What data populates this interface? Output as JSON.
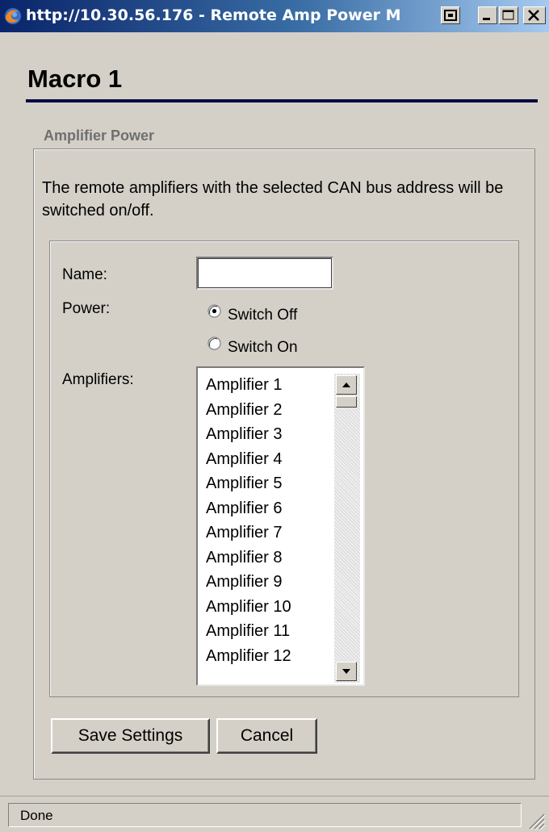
{
  "window": {
    "title": "http://10.30.56.176 - Remote Amp Power M",
    "buttons": [
      "restore-icon",
      "minimize-icon",
      "maximize-icon",
      "close-icon"
    ]
  },
  "page": {
    "title": "Macro 1"
  },
  "fieldset": {
    "legend": "Amplifier Power",
    "description": "The remote amplifiers with the selected CAN bus address will be switched on/off."
  },
  "form": {
    "name_label": "Name:",
    "name_value": "",
    "power_label": "Power:",
    "power_options": [
      "Switch Off",
      "Switch On"
    ],
    "power_selected": "Switch Off",
    "amplifiers_label": "Amplifiers:",
    "amplifiers": [
      "Amplifier 1",
      "Amplifier 2",
      "Amplifier 3",
      "Amplifier 4",
      "Amplifier 5",
      "Amplifier 6",
      "Amplifier 7",
      "Amplifier 8",
      "Amplifier 9",
      "Amplifier 10",
      "Amplifier 11",
      "Amplifier 12"
    ]
  },
  "actions": {
    "save_label": "Save Settings",
    "cancel_label": "Cancel"
  },
  "status": {
    "text": "Done"
  },
  "colors": {
    "titlebar_start": "#0a246a",
    "titlebar_end": "#a6caf0",
    "title_rule": "#0a0a40",
    "legend_text": "#6f6f6f",
    "window_bg": "#d4d0c8"
  }
}
